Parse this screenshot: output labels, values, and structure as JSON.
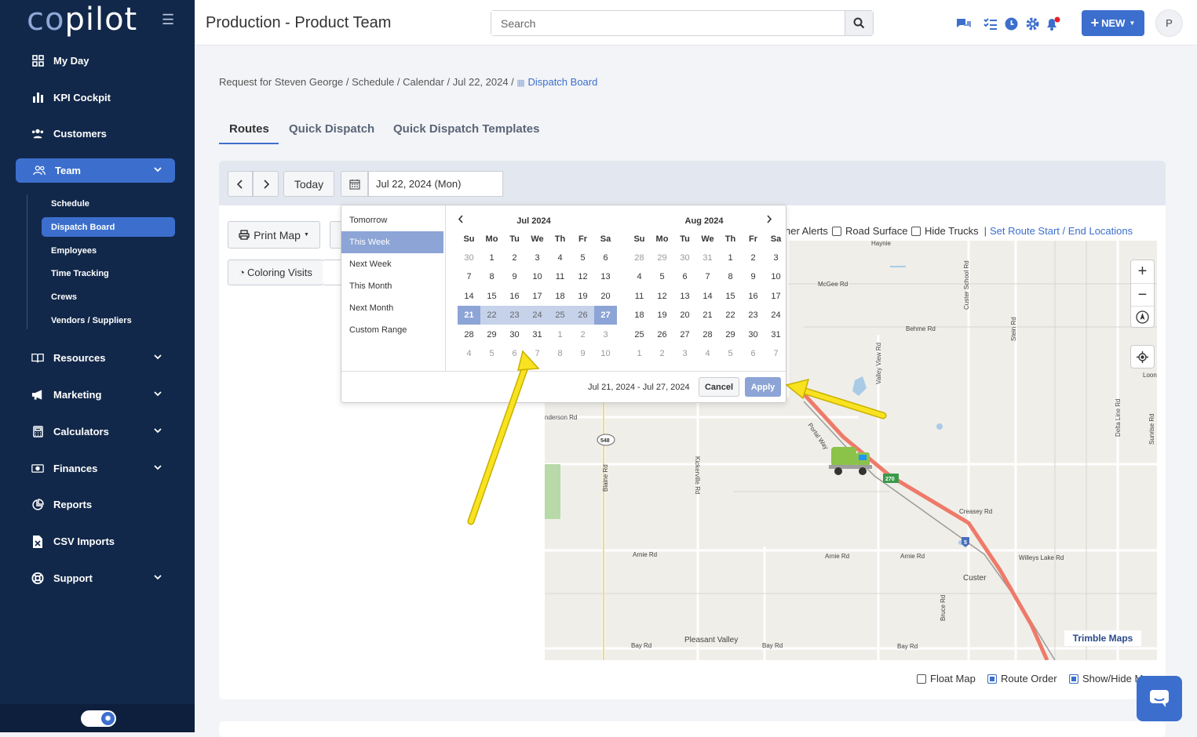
{
  "app": {
    "logo_co": "co",
    "logo_rest": "pilot"
  },
  "sidebar": {
    "items": [
      {
        "label": "My Day",
        "icon": "grid-icon"
      },
      {
        "label": "KPI Cockpit",
        "icon": "bar-chart-icon"
      },
      {
        "label": "Customers",
        "icon": "users-icon"
      },
      {
        "label": "Team",
        "icon": "team-icon"
      },
      {
        "label": "Resources",
        "icon": "book-icon"
      },
      {
        "label": "Marketing",
        "icon": "megaphone-icon"
      },
      {
        "label": "Calculators",
        "icon": "calculator-icon"
      },
      {
        "label": "Finances",
        "icon": "money-icon"
      },
      {
        "label": "Reports",
        "icon": "pie-chart-icon"
      },
      {
        "label": "CSV Imports",
        "icon": "file-csv-icon"
      },
      {
        "label": "Support",
        "icon": "lifebuoy-icon"
      }
    ],
    "team_sub": [
      "Schedule",
      "Dispatch Board",
      "Employees",
      "Time Tracking",
      "Crews",
      "Vendors / Suppliers"
    ]
  },
  "header": {
    "title": "Production - Product Team",
    "search_placeholder": "Search",
    "new_label": "NEW",
    "avatar": "P"
  },
  "breadcrumb": {
    "path": "Request for Steven George / Schedule / Calendar / Jul 22, 2024 /",
    "current": "Dispatch Board"
  },
  "tabs": [
    "Routes",
    "Quick Dispatch",
    "Quick Dispatch Templates"
  ],
  "toolbar": {
    "today": "Today",
    "date_value": "Jul 22, 2024 (Mon)",
    "print_map": "Print Map",
    "coloring": "Coloring Visits"
  },
  "map_options": {
    "weather": "her Alerts",
    "road": "Road Surface",
    "hide_trucks": "Hide Trucks",
    "route_link": "Set Route Start / End Locations",
    "float_map": "Float Map",
    "route_order": "Route Order",
    "show_hide": "Show/Hide M",
    "watermark": "Trimble Maps"
  },
  "map_labels": {
    "roads": [
      "Haynie",
      "McGee Rd",
      "Behme Rd",
      "Custer School Rd",
      "Valley View Rd",
      "Stein Rd",
      "nderson Rd",
      "Blaine Rd",
      "Kickerville Rd",
      "Portal Way",
      "Creasey Rd",
      "Arnie Rd",
      "Arnie Rd",
      "Arnie Rd",
      "Willeys Lake Rd",
      "Custer",
      "Bay Rd",
      "Bay Rd",
      "Bay Rd",
      "Pleasant Valley",
      "Delta Line Rd",
      "Sunrise Rd",
      "Bruce Rd",
      "Loon"
    ],
    "shields": [
      "548",
      "270",
      "5"
    ]
  },
  "datepicker": {
    "ranges": [
      "Tomorrow",
      "This Week",
      "Next Week",
      "This Month",
      "Next Month",
      "Custom Range"
    ],
    "active_range": "This Week",
    "dow": [
      "Su",
      "Mo",
      "Tu",
      "We",
      "Th",
      "Fr",
      "Sa"
    ],
    "left_month": "Jul 2024",
    "right_month": "Aug 2024",
    "left_days": [
      [
        "30",
        "1",
        "2",
        "3",
        "4",
        "5",
        "6"
      ],
      [
        "7",
        "8",
        "9",
        "10",
        "11",
        "12",
        "13"
      ],
      [
        "14",
        "15",
        "16",
        "17",
        "18",
        "19",
        "20"
      ],
      [
        "21",
        "22",
        "23",
        "24",
        "25",
        "26",
        "27"
      ],
      [
        "28",
        "29",
        "30",
        "31",
        "1",
        "2",
        "3"
      ],
      [
        "4",
        "5",
        "6",
        "7",
        "8",
        "9",
        "10"
      ]
    ],
    "right_days": [
      [
        "28",
        "29",
        "30",
        "31",
        "1",
        "2",
        "3"
      ],
      [
        "4",
        "5",
        "6",
        "7",
        "8",
        "9",
        "10"
      ],
      [
        "11",
        "12",
        "13",
        "14",
        "15",
        "16",
        "17"
      ],
      [
        "18",
        "19",
        "20",
        "21",
        "22",
        "23",
        "24"
      ],
      [
        "25",
        "26",
        "27",
        "28",
        "29",
        "30",
        "31"
      ],
      [
        "1",
        "2",
        "3",
        "4",
        "5",
        "6",
        "7"
      ]
    ],
    "range_text": "Jul 21, 2024 - Jul 27, 2024",
    "cancel": "Cancel",
    "apply": "Apply"
  },
  "colors": {
    "sidebar": "#12284a",
    "accent": "#3c6fcd",
    "range_sel": "#8ca4d6",
    "range_in": "#c5d2ea",
    "route": "#ee7a6a",
    "arrow": "#f9e21f"
  }
}
